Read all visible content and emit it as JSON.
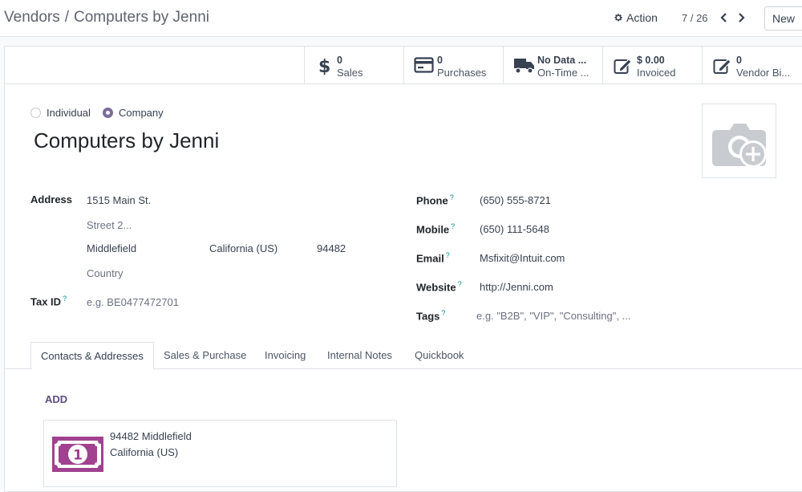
{
  "breadcrumb": {
    "parent": "Vendors",
    "separator": "/",
    "current": "Computers by Jenni"
  },
  "toolbar": {
    "action_label": "Action",
    "pager": "7 / 26",
    "new_label": "New"
  },
  "stat_buttons": [
    {
      "value": "0",
      "label": "Sales",
      "icon": "dollar-icon"
    },
    {
      "value": "0",
      "label": "Purchases",
      "icon": "credit-card-icon"
    },
    {
      "value": "No Data ...",
      "label": "On-Time ...",
      "icon": "truck-icon"
    },
    {
      "value": "$ 0.00",
      "label": "Invoiced",
      "icon": "edit-icon"
    },
    {
      "value": "0",
      "label": "Vendor Bi...",
      "icon": "edit-icon"
    }
  ],
  "company_type": {
    "individual_label": "Individual",
    "company_label": "Company",
    "selected": "Company"
  },
  "partner_name": "Computers by Jenni",
  "labels": {
    "address": "Address",
    "tax_id": "Tax ID",
    "phone": "Phone",
    "mobile": "Mobile",
    "email": "Email",
    "website": "Website",
    "tags": "Tags",
    "help_mark": "?"
  },
  "address": {
    "street": "1515 Main St.",
    "street2_placeholder": "Street 2...",
    "city": "Middlefield",
    "state": "California (US)",
    "zip": "94482",
    "country_placeholder": "Country"
  },
  "tax_id_placeholder": "e.g. BE0477472701",
  "contact": {
    "phone": "(650) 555-8721",
    "mobile": "(650) 111-5648",
    "email": "Msfixit@Intuit.com",
    "website": "http://Jenni.com",
    "tags_placeholder": "e.g. \"B2B\", \"VIP\", \"Consulting\", ..."
  },
  "tabs": [
    "Contacts & Addresses",
    "Sales & Purchase",
    "Invoicing",
    "Internal Notes",
    "Quickbook"
  ],
  "active_tab": "Contacts & Addresses",
  "add_label": "ADD",
  "address_card": {
    "line1": "94482 Middlefield",
    "line2": "California (US)",
    "icon": "money-icon"
  },
  "colors": {
    "accent": "#7c6c9c",
    "link": "#5d4d83",
    "card_icon": "#a0428f",
    "help": "#008f8c"
  }
}
